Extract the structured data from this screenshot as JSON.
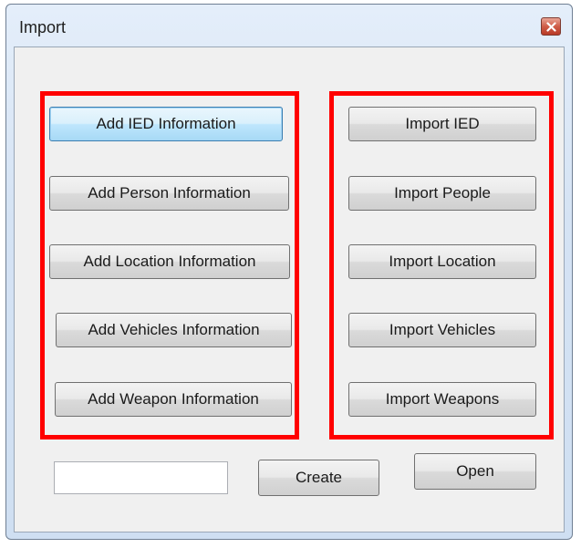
{
  "window": {
    "title": "Import"
  },
  "add_group": {
    "buttons": [
      "Add IED Information",
      "Add Person Information",
      "Add Location Information",
      "Add Vehicles Information",
      "Add Weapon Information"
    ]
  },
  "import_group": {
    "buttons": [
      "Import IED",
      "Import People",
      "Import Location",
      "Import Vehicles",
      "Import Weapons"
    ]
  },
  "bottom": {
    "name_input_value": "",
    "create_label": "Create",
    "open_label": "Open"
  },
  "colors": {
    "highlight_border": "#ff0000",
    "dialog_face": "#f0f0f0",
    "title_gradient": "#d5e3f4",
    "close_button": "#cf5d48"
  }
}
